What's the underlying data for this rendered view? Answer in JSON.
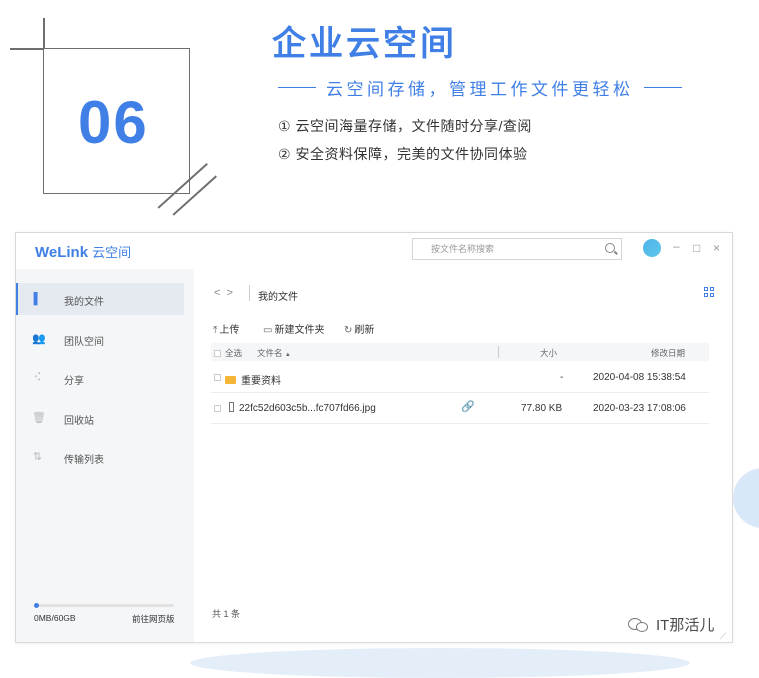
{
  "promo": {
    "number": "06",
    "title": "企业云空间",
    "subtitle": "云空间存储，管理工作文件更轻松",
    "points": [
      "① 云空间海量存储，文件随时分享/查阅",
      "② 安全资料保障，完美的文件协同体验"
    ]
  },
  "app": {
    "logo": "WeLink",
    "logo_sub": "云空间",
    "search_placeholder": "按文件名称搜索",
    "window_controls": {
      "minimize": "–",
      "maximize": "□",
      "close": "×"
    }
  },
  "sidebar": {
    "items": [
      {
        "label": "我的文件",
        "icon": "file-icon",
        "glyph": "▌"
      },
      {
        "label": "团队空间",
        "icon": "team-icon",
        "glyph": "👥"
      },
      {
        "label": "分享",
        "icon": "share-icon",
        "glyph": "⠪"
      },
      {
        "label": "回收站",
        "icon": "trash-icon",
        "glyph": "🗑"
      },
      {
        "label": "传输列表",
        "icon": "transfer-icon",
        "glyph": "⇅"
      }
    ],
    "storage": {
      "text": "0MB/60GB",
      "used_fraction": 0.0
    },
    "web_link": "前往网页版"
  },
  "main": {
    "nav": {
      "back": "<",
      "forward": ">"
    },
    "breadcrumb": "我的文件",
    "toolbar": {
      "upload_icon": "⤒",
      "upload": "上传",
      "new_folder_icon": "▭",
      "new_folder": "新建文件夹",
      "refresh_icon": "↻",
      "refresh": "刷新"
    },
    "table": {
      "headers": {
        "select_all": "全选",
        "name": "文件名",
        "sort": "▲",
        "size": "大小",
        "modified": "修改日期"
      },
      "rows": [
        {
          "type": "folder",
          "name": "重要资料",
          "size": "-",
          "modified": "2020-04-08 15:38:54"
        },
        {
          "type": "file",
          "name": "22fc52d603c5b...fc707fd66.jpg",
          "size": "77.80 KB",
          "modified": "2020-03-23 17:08:06",
          "link_icon": "🔗"
        }
      ]
    },
    "count": "共 1 条"
  },
  "watermark": "IT那活儿",
  "colors": {
    "accent": "#3f7fe6",
    "folder": "#f5b638"
  }
}
